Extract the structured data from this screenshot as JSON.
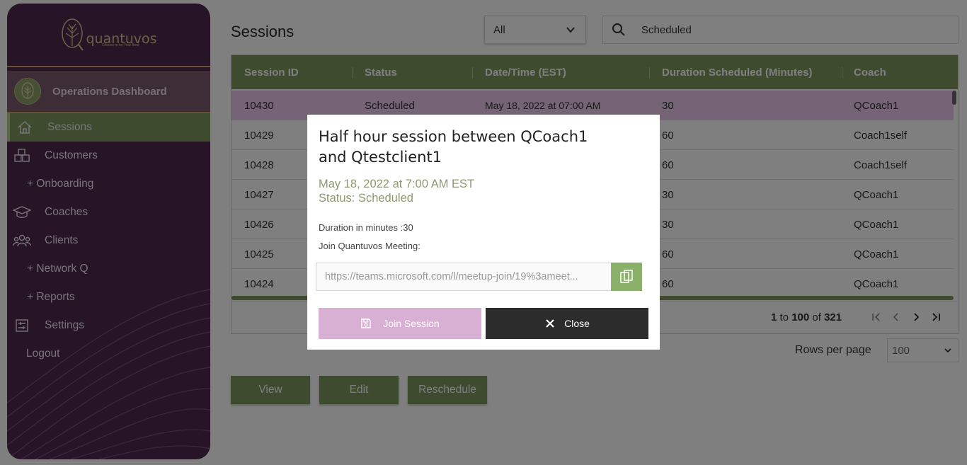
{
  "brand": {
    "name": "quantuvos",
    "tagline": "Choose to be Your Best"
  },
  "sidebar": {
    "dashboard_label": "Operations Dashboard",
    "items": [
      {
        "label": "Sessions",
        "icon": "home-icon",
        "active": true
      },
      {
        "label": "Customers",
        "icon": "boxes-icon"
      },
      {
        "label": "+ Onboarding"
      },
      {
        "label": "Coaches",
        "icon": "graduation-cap-icon"
      },
      {
        "label": "Clients",
        "icon": "users-icon"
      },
      {
        "label": "+ Network Q"
      },
      {
        "label": "+ Reports"
      },
      {
        "label": "Settings",
        "icon": "settings-icon"
      },
      {
        "label": "Logout"
      }
    ]
  },
  "main": {
    "title": "Sessions",
    "filter": {
      "selected": "All"
    },
    "search": {
      "value": "Scheduled"
    },
    "table": {
      "columns": [
        "Session ID",
        "Status",
        "Date/Time (EST)",
        "Duration Scheduled (Minutes)",
        "Coach"
      ],
      "rows": [
        [
          "10430",
          "Scheduled",
          "May 18, 2022 at 07:00 AM",
          "30",
          "QCoach1"
        ],
        [
          "10429",
          "",
          "",
          "60",
          "Coach1self"
        ],
        [
          "10428",
          "",
          "",
          "60",
          "Coach1self"
        ],
        [
          "10427",
          "",
          "",
          "30",
          "QCoach1"
        ],
        [
          "10426",
          "",
          "",
          "30",
          "QCoach1"
        ],
        [
          "10425",
          "",
          "",
          "60",
          "QCoach1"
        ],
        [
          "10424",
          "",
          "",
          "60",
          "QCoach1"
        ]
      ]
    },
    "pagination": {
      "start": "1",
      "to": "to",
      "end": "100",
      "of": "of",
      "total": "321"
    },
    "rows_per_page": {
      "label": "Rows per page",
      "value": "100"
    },
    "actions": {
      "view": "View",
      "edit": "Edit",
      "reschedule": "Reschedule"
    }
  },
  "modal": {
    "title": "Half hour session between QCoach1 and Qtestclient1",
    "when": "May 18, 2022 at 7:00 AM EST",
    "status": "Status: Scheduled",
    "duration": "Duration in minutes :30",
    "join_label": "Join Quantuvos Meeting:",
    "meeting_url": "https://teams.microsoft.com/l/meetup-join/19%3ameet...",
    "join_button": "Join Session",
    "close_button": "Close"
  },
  "colors": {
    "sidebar_bg": "#4e2a4e",
    "accent_green": "#7c965c",
    "join_button": "#d8b0d4",
    "close_button": "#2c2c2c"
  }
}
